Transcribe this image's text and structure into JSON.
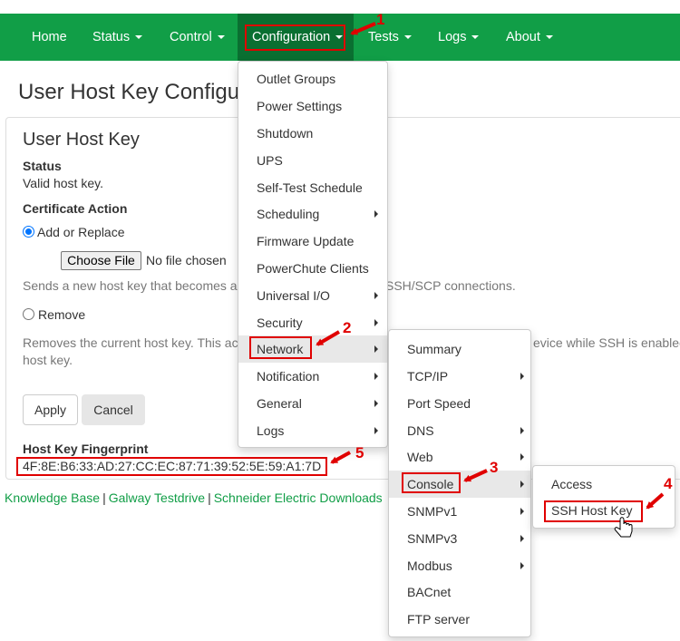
{
  "navbar": {
    "items": [
      {
        "label": "Home",
        "caret": false
      },
      {
        "label": "Status",
        "caret": true
      },
      {
        "label": "Control",
        "caret": true
      },
      {
        "label": "Configuration",
        "caret": true
      },
      {
        "label": "Tests",
        "caret": true
      },
      {
        "label": "Logs",
        "caret": true
      },
      {
        "label": "About",
        "caret": true
      }
    ],
    "active": "Configuration",
    "bg_color": "#119e47",
    "active_color": "#0a6f31"
  },
  "page": {
    "title": "User Host Key Configu",
    "section_title": "User Host Key",
    "status_label": "Status",
    "status_value": "Valid host key.",
    "cert_action_label": "Certificate Action",
    "add_replace_label": "Add or Replace",
    "choose_file_label": "Choose File",
    "no_file_text": "No file chosen",
    "add_help_start": "Sends a new host key that becomes ac",
    "add_help_end": "SSH/SCP connections.",
    "remove_label": "Remove",
    "remove_help_line1_start": "Removes the current host key. This ac",
    "remove_help_line1_end": "evice while SSH is enabled",
    "remove_help_line2": "host key.",
    "apply_label": "Apply",
    "cancel_label": "Cancel",
    "fingerprint_label": "Host Key Fingerprint",
    "fingerprint_value": "4F:8E:B6:33:AD:27:CC:EC:87:71:39:52:5E:59:A1:7D"
  },
  "footer": {
    "links": [
      "Knowledge Base",
      "Galway Testdrive",
      "Schneider Electric Downloads"
    ],
    "link_color": "#119e47"
  },
  "config_menu": {
    "items": [
      {
        "label": "Outlet Groups",
        "submenu": false
      },
      {
        "label": "Power Settings",
        "submenu": false
      },
      {
        "label": "Shutdown",
        "submenu": false
      },
      {
        "label": "UPS",
        "submenu": false
      },
      {
        "label": "Self-Test Schedule",
        "submenu": false
      },
      {
        "label": "Scheduling",
        "submenu": true
      },
      {
        "label": "Firmware Update",
        "submenu": false
      },
      {
        "label": "PowerChute Clients",
        "submenu": false
      },
      {
        "label": "Universal I/O",
        "submenu": true
      },
      {
        "label": "Security",
        "submenu": true
      },
      {
        "label": "Network",
        "submenu": true
      },
      {
        "label": "Notification",
        "submenu": true
      },
      {
        "label": "General",
        "submenu": true
      },
      {
        "label": "Logs",
        "submenu": true
      }
    ],
    "highlighted": "Network"
  },
  "network_menu": {
    "items": [
      {
        "label": "Summary",
        "submenu": false
      },
      {
        "label": "TCP/IP",
        "submenu": true
      },
      {
        "label": "Port Speed",
        "submenu": false
      },
      {
        "label": "DNS",
        "submenu": true
      },
      {
        "label": "Web",
        "submenu": true
      },
      {
        "label": "Console",
        "submenu": true
      },
      {
        "label": "SNMPv1",
        "submenu": true
      },
      {
        "label": "SNMPv3",
        "submenu": true
      },
      {
        "label": "Modbus",
        "submenu": true
      },
      {
        "label": "BACnet",
        "submenu": false
      },
      {
        "label": "FTP server",
        "submenu": false
      }
    ],
    "highlighted": "Console"
  },
  "console_menu": {
    "items": [
      {
        "label": "Access",
        "submenu": false
      },
      {
        "label": "SSH Host Key",
        "submenu": false
      }
    ]
  },
  "annotations": {
    "step1": "1",
    "step2": "2",
    "step3": "3",
    "step4": "4",
    "step5": "5",
    "color": "#e00000"
  }
}
